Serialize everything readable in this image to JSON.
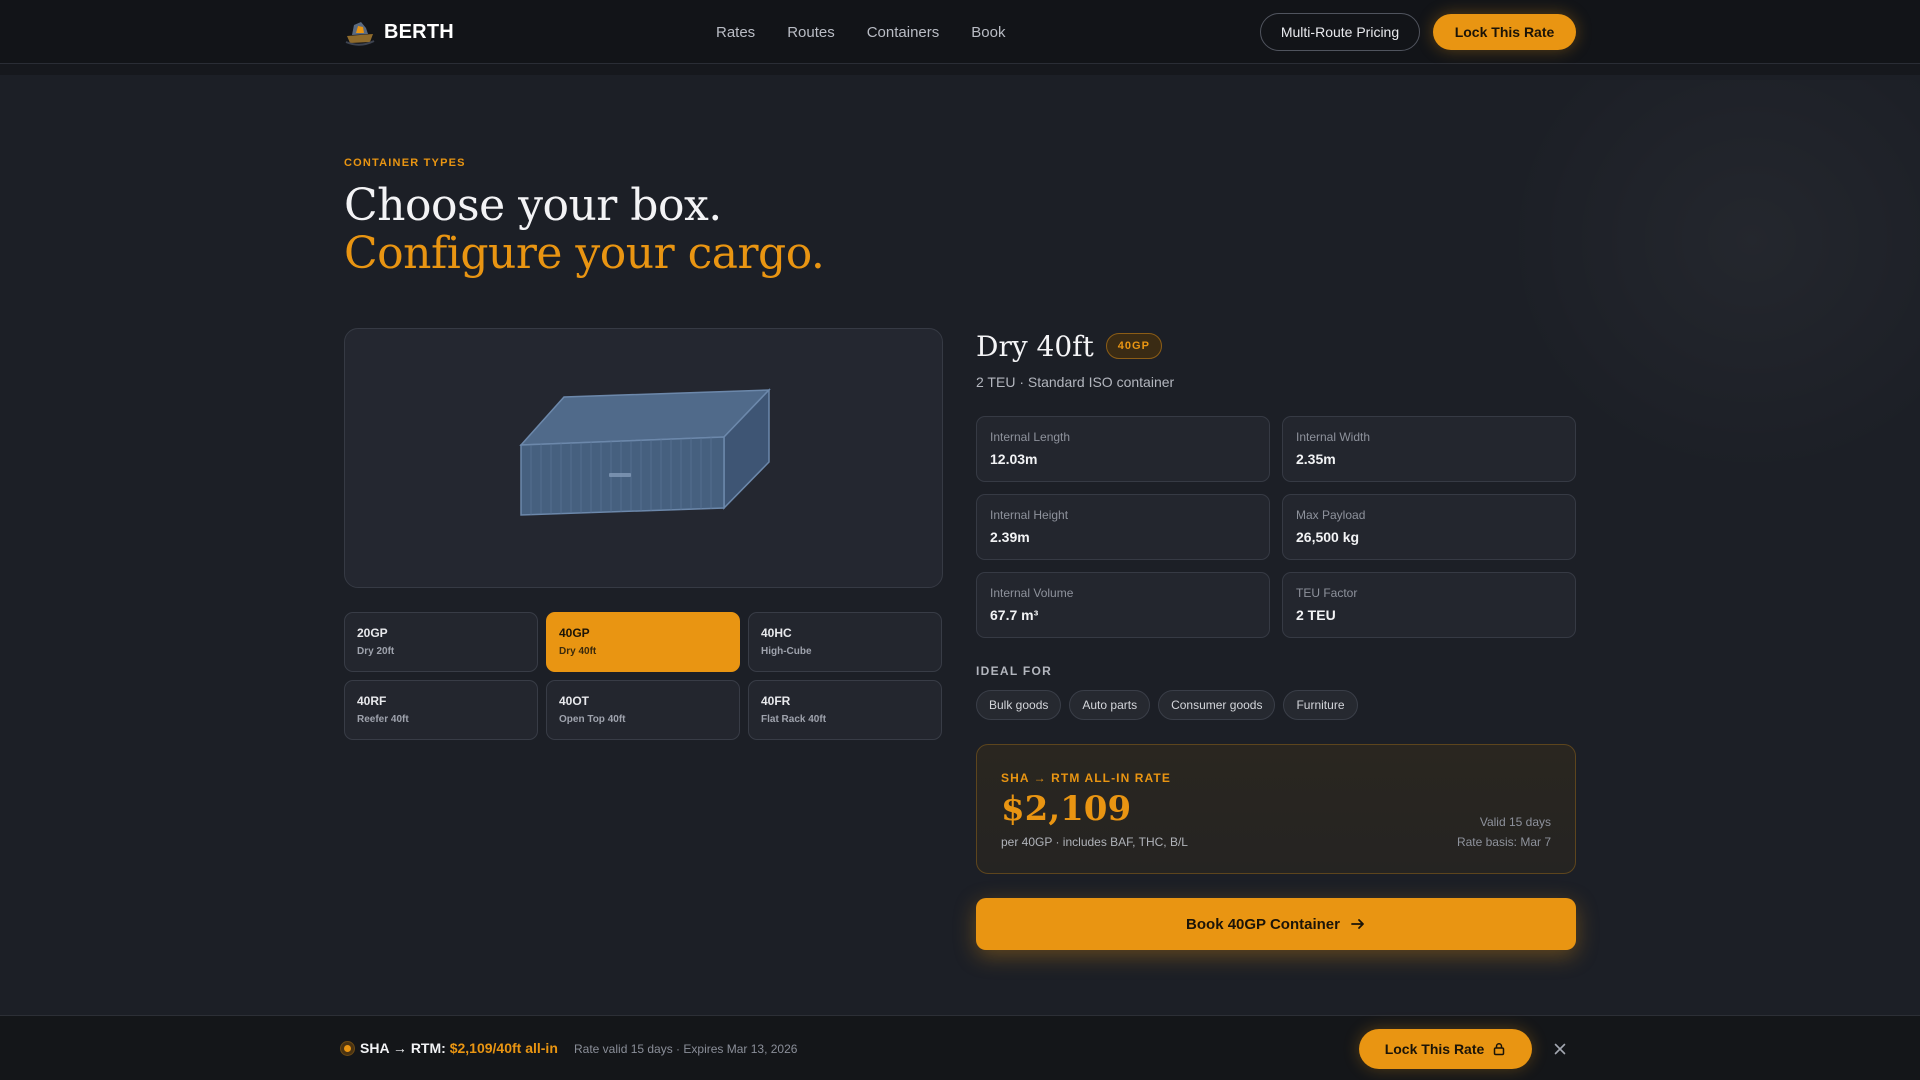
{
  "header": {
    "brand": "BERTH",
    "nav": [
      "Rates",
      "Routes",
      "Containers",
      "Book"
    ],
    "multi_route_label": "Multi-Route Pricing",
    "lock_rate_label": "Lock This Rate"
  },
  "hero": {
    "eyebrow": "CONTAINER TYPES",
    "title_line1": "Choose your box.",
    "title_line2": "Configure your cargo."
  },
  "container_types": [
    {
      "code": "20GP",
      "name": "Dry 20ft",
      "active": false
    },
    {
      "code": "40GP",
      "name": "Dry 40ft",
      "active": true
    },
    {
      "code": "40HC",
      "name": "High-Cube",
      "active": false
    },
    {
      "code": "40RF",
      "name": "Reefer 40ft",
      "active": false
    },
    {
      "code": "40OT",
      "name": "Open Top 40ft",
      "active": false
    },
    {
      "code": "40FR",
      "name": "Flat Rack 40ft",
      "active": false
    }
  ],
  "detail": {
    "name": "Dry 40ft",
    "badge": "40GP",
    "subtitle": "2 TEU · Standard ISO container",
    "specs": [
      {
        "label": "Internal Length",
        "value": "12.03m"
      },
      {
        "label": "Internal Width",
        "value": "2.35m"
      },
      {
        "label": "Internal Height",
        "value": "2.39m"
      },
      {
        "label": "Max Payload",
        "value": "26,500 kg"
      },
      {
        "label": "Internal Volume",
        "value": "67.7 m³"
      },
      {
        "label": "TEU Factor",
        "value": "2 TEU"
      }
    ],
    "ideal_for_label": "IDEAL FOR",
    "ideal_for": [
      "Bulk goods",
      "Auto parts",
      "Consumer goods",
      "Furniture"
    ]
  },
  "rate": {
    "heading": "SHA → RTM ALL-IN RATE",
    "price": "$2,109",
    "note": "per 40GP · includes BAF, THC, B/L",
    "valid": "Valid 15 days",
    "basis": "Rate basis: Mar 7"
  },
  "book_button": "Book 40GP Container",
  "sticky": {
    "route": "SHA → RTM:",
    "price": "$2,109/40ft all-in",
    "meta": "Rate valid 15 days · Expires Mar 13, 2026",
    "button": "Lock This Rate"
  },
  "colors": {
    "accent": "#e99512",
    "background": "#1c1f26",
    "header": "#121418",
    "container_blue": "#46607f"
  },
  "icons": {
    "logo": "ship-logo-icon",
    "book_arrow": "arrow-right-icon",
    "lock": "lock-icon",
    "close": "close-icon"
  }
}
